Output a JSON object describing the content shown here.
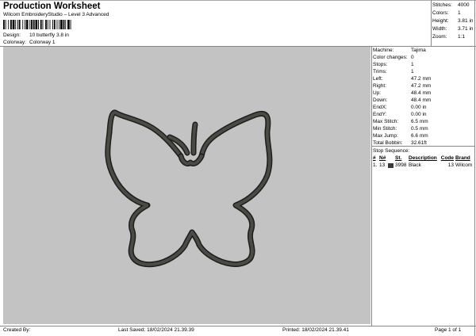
{
  "header": {
    "title": "Production Worksheet",
    "subtitle": "Wilcom EmbroideryStudio – Level 3 Advanced"
  },
  "meta": {
    "design_label": "Design:",
    "design_value": "10 butterfly 3.8 in",
    "colorway_label": "Colorway:",
    "colorway_value": "Colorway 1"
  },
  "stats": [
    {
      "label": "Stitches:",
      "value": "4000"
    },
    {
      "label": "Colors:",
      "value": "1"
    },
    {
      "label": "Height:",
      "value": "3.81 in"
    },
    {
      "label": "Width:",
      "value": "3.71 in"
    },
    {
      "label": "Zoom:",
      "value": "1:1"
    }
  ],
  "machine_info": [
    {
      "label": "Machine:",
      "value": "Tajima"
    },
    {
      "label": "Color changes:",
      "value": "0"
    },
    {
      "label": "Stops:",
      "value": "1"
    },
    {
      "label": "Trims:",
      "value": "1"
    },
    {
      "label": "Left:",
      "value": "47.2 mm"
    },
    {
      "label": "Right:",
      "value": "47.2 mm"
    },
    {
      "label": "Up:",
      "value": "48.4 mm"
    },
    {
      "label": "Down:",
      "value": "48.4 mm"
    },
    {
      "label": "EndX:",
      "value": "0.00 in"
    },
    {
      "label": "EndY:",
      "value": "0.00 in"
    },
    {
      "label": "Max Stitch:",
      "value": "6.5 mm"
    },
    {
      "label": "Min Stitch:",
      "value": "0.5 mm"
    },
    {
      "label": "Max Jump:",
      "value": "6.6 mm"
    },
    {
      "label": "Total Bobbin:",
      "value": "32.61ft"
    }
  ],
  "stop_sequence": {
    "title": "Stop Sequence:",
    "headers": {
      "idx": "#",
      "n": "N#",
      "st": "St.",
      "desc": "Description",
      "code": "Code",
      "brand": "Brand"
    },
    "rows": [
      {
        "idx": "1.",
        "n": "13",
        "st": "3998",
        "desc": "Black",
        "code": "13",
        "brand": "Wilcom",
        "color": "#3a3a3a"
      }
    ]
  },
  "footer": {
    "created_by": "Created By:",
    "last_saved": "Last Saved: 18/02/2024 21.39.39",
    "printed": "Printed: 18/02/2024 21.39.41",
    "page": "Page 1 of 1"
  },
  "design_colors": {
    "canvas_bg": "#c3c3c3",
    "thread": "#3a3a36"
  }
}
